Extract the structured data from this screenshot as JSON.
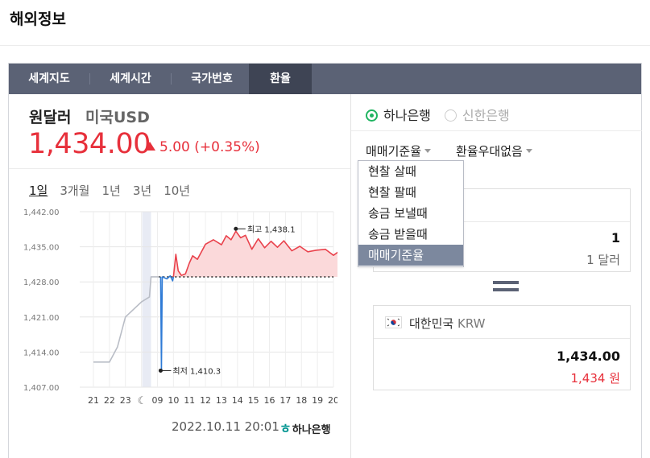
{
  "page": {
    "title": "해외정보"
  },
  "tabs": [
    {
      "label": "세계지도"
    },
    {
      "label": "세계시간"
    },
    {
      "label": "국가번호"
    },
    {
      "label": "환율"
    }
  ],
  "rate": {
    "name": "원달러",
    "sub": "미국USD",
    "price": "1,434.00",
    "change": "5.00",
    "change_pct": "(+0.35%)",
    "direction": "up",
    "color_up": "#e7303b"
  },
  "periods": [
    {
      "label": "1일"
    },
    {
      "label": "3개월"
    },
    {
      "label": "1년"
    },
    {
      "label": "3년"
    },
    {
      "label": "10년"
    }
  ],
  "chart_data": {
    "type": "line",
    "xlabel": "",
    "ylabel": "",
    "ylim": [
      1407,
      1442
    ],
    "y_ticks": [
      "1,442.00",
      "1,435.00",
      "1,428.00",
      "1,421.00",
      "1,414.00",
      "1,407.00"
    ],
    "y_tick_values": [
      1442,
      1435,
      1428,
      1421,
      1414,
      1407
    ],
    "x_ticks": [
      "21",
      "22",
      "23",
      "moon",
      "09",
      "10",
      "11",
      "12",
      "13",
      "14",
      "15",
      "16",
      "17",
      "18",
      "19",
      "20"
    ],
    "reference_value": 1429.0,
    "annotations": [
      {
        "label": "최고 1,438.1",
        "value": 1438.1
      },
      {
        "label": "최저 1,410.3",
        "value": 1410.3
      }
    ],
    "series": [
      {
        "name": "",
        "color": "#b9bdc6",
        "points": [
          [
            0,
            1412
          ],
          [
            1,
            1412
          ],
          [
            1.5,
            1415
          ],
          [
            2,
            1421
          ],
          [
            3,
            1424
          ],
          [
            3.5,
            1425
          ],
          [
            3.6,
            1429
          ],
          [
            4.1,
            1429
          ]
        ]
      },
      {
        "name": "",
        "color": "#2f7bd6",
        "points": [
          [
            4.2,
            1429
          ],
          [
            4.25,
            1410.3
          ],
          [
            4.3,
            1429
          ],
          [
            4.6,
            1428.6
          ],
          [
            4.8,
            1429.2
          ],
          [
            4.95,
            1428.2
          ],
          [
            5.0,
            1429
          ]
        ]
      },
      {
        "name": "",
        "color": "#e9424c",
        "points": [
          [
            5.0,
            1429
          ],
          [
            5.15,
            1433.5
          ],
          [
            5.3,
            1430.2
          ],
          [
            5.5,
            1429.3
          ],
          [
            5.75,
            1429.6
          ],
          [
            6.0,
            1431.8
          ],
          [
            6.2,
            1433.2
          ],
          [
            6.5,
            1432.5
          ],
          [
            7.0,
            1435.5
          ],
          [
            7.5,
            1436.4
          ],
          [
            8.0,
            1435.4
          ],
          [
            8.3,
            1437.2
          ],
          [
            8.6,
            1436.4
          ],
          [
            8.9,
            1438.1
          ],
          [
            9.2,
            1436.8
          ],
          [
            9.5,
            1437.3
          ],
          [
            9.9,
            1434.5
          ],
          [
            10.3,
            1436.6
          ],
          [
            10.7,
            1434.8
          ],
          [
            11.1,
            1436.1
          ],
          [
            11.5,
            1434.9
          ],
          [
            11.9,
            1436.2
          ],
          [
            12.4,
            1434.2
          ],
          [
            12.9,
            1435.1
          ],
          [
            13.4,
            1434.0
          ],
          [
            13.9,
            1434.3
          ],
          [
            14.5,
            1434.5
          ],
          [
            15.0,
            1433.3
          ],
          [
            15.4,
            1434.2
          ]
        ]
      }
    ]
  },
  "chart_footer": {
    "datetime": "2022.10.11 20:01",
    "bank": "하나은행"
  },
  "banks": [
    {
      "label": "하나은행",
      "selected": true
    },
    {
      "label": "신한은행",
      "selected": false
    }
  ],
  "filters": {
    "rate_type": "매매기준율",
    "preferential": "환율우대없음"
  },
  "dropdown": {
    "items": [
      {
        "label": "현찰 살때"
      },
      {
        "label": "현찰 팔때"
      },
      {
        "label": "송금 보낼때"
      },
      {
        "label": "송금 받을때"
      },
      {
        "label": "매매기준율",
        "selected": true
      }
    ]
  },
  "usd_card": {
    "amount": "1",
    "unit": "1 달러"
  },
  "krw_card": {
    "country": "대한민국",
    "code": "KRW",
    "amount": "1,434.00",
    "unit": "1,434 원"
  }
}
